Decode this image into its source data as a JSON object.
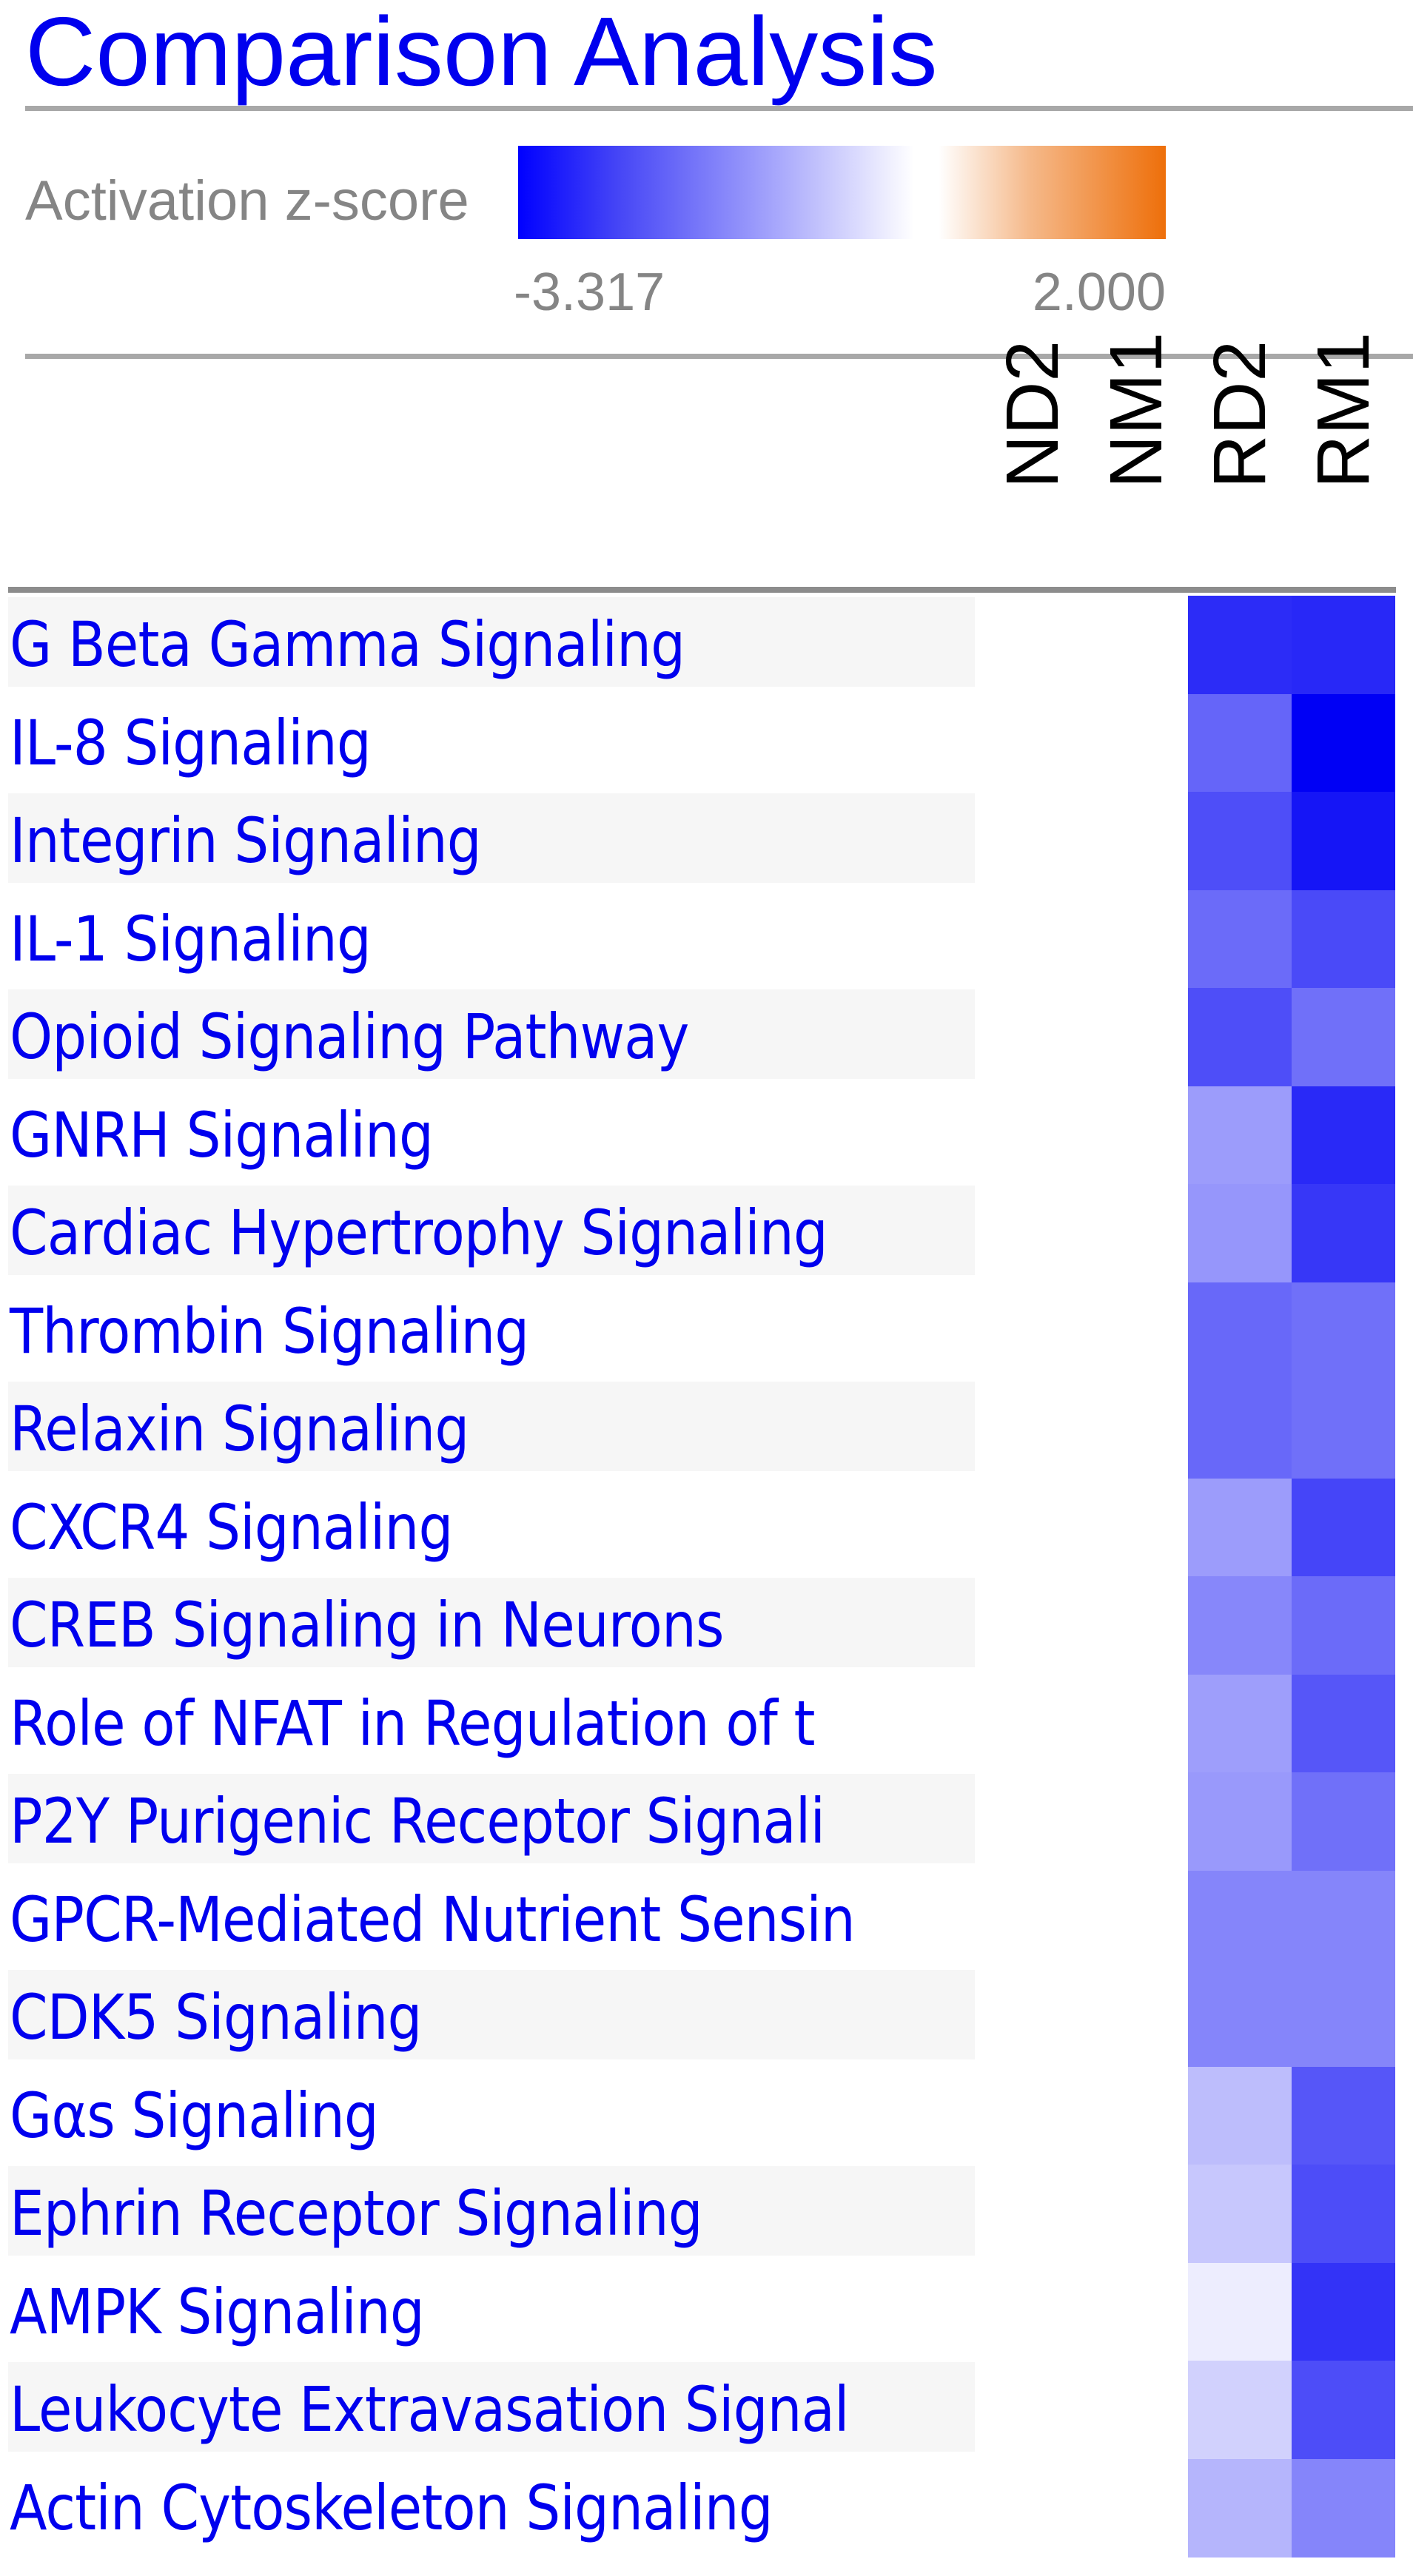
{
  "title": "Comparison Analysis",
  "legend": {
    "label": "Activation z-score",
    "min_label": "-3.317",
    "max_label": "2.000",
    "min_value": -3.317,
    "max_value": 2.0,
    "negative_color": "#0000FF",
    "neutral_color": "#FFFFFF",
    "positive_color": "#EE6F0A"
  },
  "colors": {
    "title": "#0000EE",
    "row_label": "#0000EE",
    "legend_text": "#858585",
    "header_text": "#000000",
    "stripe": "#F6F6F6",
    "divider": "#8C8C8C"
  },
  "chart_data": {
    "type": "heatmap",
    "title": "Comparison Analysis",
    "colorbar": {
      "label": "Activation z-score",
      "range": [
        -3.317,
        2.0
      ]
    },
    "columns": [
      "ND2",
      "NM1",
      "RD2",
      "RM1"
    ],
    "rows": [
      {
        "label": "G Beta Gamma Signaling",
        "values": [
          null,
          null,
          -2.75,
          -2.8
        ]
      },
      {
        "label": "IL-8 Signaling",
        "values": [
          null,
          null,
          -2.0,
          -3.317
        ]
      },
      {
        "label": "Integrin Signaling",
        "values": [
          null,
          null,
          -2.3,
          -3.05
        ]
      },
      {
        "label": "IL-1 Signaling",
        "values": [
          null,
          null,
          -1.93,
          -2.36
        ]
      },
      {
        "label": "Opioid Signaling Pathway",
        "values": [
          null,
          null,
          -2.3,
          -1.86
        ]
      },
      {
        "label": "GNRH Signaling",
        "values": [
          null,
          null,
          -1.29,
          -2.79
        ]
      },
      {
        "label": "Cardiac Hypertrophy Signaling",
        "values": [
          null,
          null,
          -1.36,
          -2.6
        ]
      },
      {
        "label": "Thrombin Signaling",
        "values": [
          null,
          null,
          -1.96,
          -1.86
        ]
      },
      {
        "label": "Relaxin Signaling",
        "values": [
          null,
          null,
          -1.96,
          -1.86
        ]
      },
      {
        "label": "CXCR4 Signaling",
        "values": [
          null,
          null,
          -1.29,
          -2.42
        ]
      },
      {
        "label": "CREB Signaling in Neurons",
        "values": [
          null,
          null,
          -1.56,
          -1.93
        ]
      },
      {
        "label": "Role of NFAT in Regulation of t",
        "values": [
          null,
          null,
          -1.26,
          -2.2
        ]
      },
      {
        "label": "P2Y Purigenic Receptor Signali",
        "values": [
          null,
          null,
          -1.33,
          -1.86
        ]
      },
      {
        "label": "GPCR-Mediated Nutrient Sensin",
        "values": [
          null,
          null,
          -1.59,
          -1.59
        ]
      },
      {
        "label": "CDK5 Signaling",
        "values": [
          null,
          null,
          -1.59,
          -1.59
        ]
      },
      {
        "label": "Gαs Signaling",
        "values": [
          null,
          null,
          -0.86,
          -2.2
        ]
      },
      {
        "label": "Ephrin Receptor Signaling",
        "values": [
          null,
          null,
          -0.73,
          -2.32
        ]
      },
      {
        "label": "AMPK Signaling",
        "values": [
          null,
          null,
          -0.23,
          -2.65
        ]
      },
      {
        "label": "Leukocyte Extravasation Signal",
        "values": [
          null,
          null,
          -0.6,
          -2.32
        ]
      },
      {
        "label": "Actin Cytoskeleton Signaling",
        "values": [
          null,
          null,
          -0.96,
          -1.59
        ]
      }
    ]
  }
}
